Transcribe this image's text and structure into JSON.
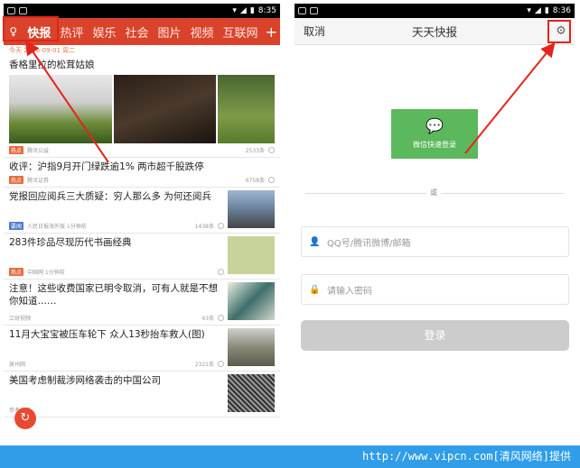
{
  "left": {
    "status_time": "8:35",
    "tabs": [
      {
        "label": "快报",
        "active": true
      },
      {
        "label": "热评",
        "active": false
      },
      {
        "label": "娱乐",
        "active": false
      },
      {
        "label": "社会",
        "active": false
      },
      {
        "label": "图片",
        "active": false
      },
      {
        "label": "视频",
        "active": false
      },
      {
        "label": "互联网",
        "active": false
      }
    ],
    "date_line": "今天 2016-09-01 周二",
    "feed": [
      {
        "title": "香格里拉的松茸姑娘",
        "tag": "热点",
        "source": "腾讯公益",
        "count": "2533条"
      },
      {
        "title": "收评：沪指9月开门绿跌逾1% 两市超千股跌停",
        "tag": "热点",
        "source": "腾讯证券",
        "count": "6758条"
      }
    ],
    "rows": [
      {
        "title": "党报回应阅兵三大质疑：穷人那么多 为何还阅兵",
        "tag": "要闻",
        "source": "人民日报海外版 1分钟前",
        "count": "1438条"
      },
      {
        "title": "283件珍品尽现历代书画经典",
        "tag": "热点",
        "source": "中国网 1分钟前",
        "count": ""
      },
      {
        "title": "注意！这些收费国家已明令取消，可有人就是不想你知道……",
        "tag": "",
        "source": "江财视频",
        "count": "43条"
      },
      {
        "title": "11月大宝宝被压车轮下 众人13秒抬车救人(图)",
        "tag": "",
        "source": "泉州网",
        "count": "2321条"
      },
      {
        "title": "美国考虑制裁涉网络袭击的中国公司",
        "tag": "",
        "source": "参考消息",
        "count": ""
      }
    ]
  },
  "right": {
    "status_time": "8:36",
    "cancel_label": "取消",
    "title": "天天快报",
    "wechat_label": "微信快速登录",
    "or_label": "或",
    "account_placeholder": "QQ号/腾讯微博/邮箱",
    "password_placeholder": "请输入密码",
    "login_label": "登录"
  },
  "footer_text": "http://www.vipcn.com[清风网络]提供",
  "colors": {
    "nav_red": "#d9432b",
    "wechat_green": "#5cb85c",
    "annotation_red": "#e2251b",
    "footer_blue": "#2f9de8"
  }
}
